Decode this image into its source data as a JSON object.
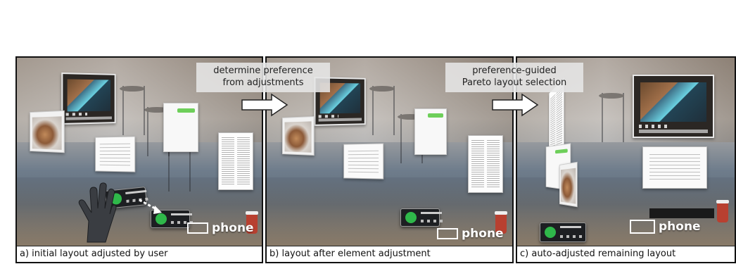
{
  "panels": [
    {
      "caption": "a) initial layout adjusted by user",
      "phone_label": "phone"
    },
    {
      "caption": "b) layout after element adjustment",
      "phone_label": "phone"
    },
    {
      "caption": "c) auto-adjusted remaining  layout",
      "phone_label": "phone"
    }
  ],
  "callouts": [
    {
      "line1": "determine preference",
      "line2": "from adjustments"
    },
    {
      "line1": "preference-guided",
      "line2": "Pareto layout selection"
    }
  ],
  "colors": {
    "border": "#111111",
    "caption_bg": "#ffffff",
    "callout_bg": "#e6e6e6",
    "accent_green": "#6ecf5a",
    "arrow": "#ffffff"
  },
  "icons": [
    "hand-icon",
    "arrow-right-icon",
    "phone-frame-icon",
    "music-disc-icon"
  ]
}
